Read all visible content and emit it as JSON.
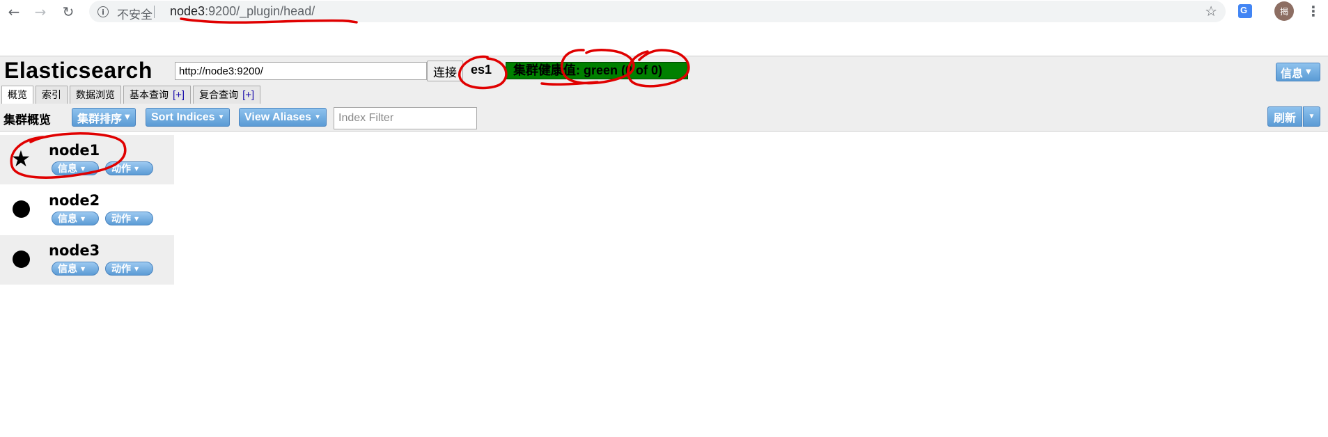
{
  "browser": {
    "back_icon": "arrow-left-icon",
    "forward_icon": "arrow-right-icon",
    "reload_icon": "reload-icon",
    "security_label": "不安全",
    "url_host": "node3",
    "url_rest": ":9200/_plugin/head/",
    "avatar_text": "揭"
  },
  "header": {
    "title": "Elasticsearch",
    "connect_url": "http://node3:9200/",
    "connect_label": "连接",
    "cluster_name": "es1",
    "health_text": "集群健康值: green (0 of 0)",
    "health_color": "#008000",
    "info_label": "信息"
  },
  "tabs": [
    {
      "label": "概览",
      "plus": ""
    },
    {
      "label": "索引",
      "plus": ""
    },
    {
      "label": "数据浏览",
      "plus": ""
    },
    {
      "label": "基本查询",
      "plus": "[+]"
    },
    {
      "label": "复合查询",
      "plus": "[+]"
    }
  ],
  "toolbar": {
    "title": "集群概览",
    "sort_cluster_label": "集群排序",
    "sort_indices_label": "Sort Indices",
    "view_aliases_label": "View Aliases",
    "index_filter_placeholder": "Index Filter",
    "refresh_label": "刷新"
  },
  "nodes": [
    {
      "name": "node1",
      "symbol": "star-icon",
      "info_label": "信息",
      "action_label": "动作"
    },
    {
      "name": "node2",
      "symbol": "circle-icon",
      "info_label": "信息",
      "action_label": "动作"
    },
    {
      "name": "node3",
      "symbol": "circle-icon",
      "info_label": "信息",
      "action_label": "动作"
    }
  ],
  "colors": {
    "button_blue": "#5b9bd5",
    "annotation_red": "#e00000",
    "header_bg": "#eeeeee"
  }
}
